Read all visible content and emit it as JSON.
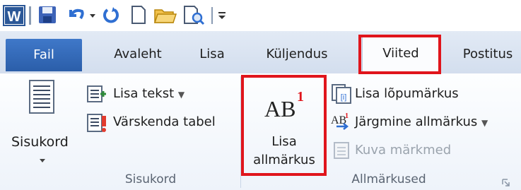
{
  "quick_access": {
    "icons": [
      "word-icon",
      "save-icon",
      "undo-icon",
      "dropdown-arrow-icon",
      "redo-icon",
      "new-document-icon",
      "open-folder-icon",
      "print-preview-icon",
      "customize-qat-icon"
    ]
  },
  "tabs": [
    {
      "label": "Fail"
    },
    {
      "label": "Avaleht"
    },
    {
      "label": "Lisa"
    },
    {
      "label": "Küljendus"
    },
    {
      "label": "Viited"
    },
    {
      "label": "Postitus"
    }
  ],
  "groups": {
    "toc": {
      "label": "Sisukord",
      "big_button": "Sisukord",
      "add_text": "Lisa tekst",
      "update_table": "Värskenda tabel"
    },
    "footnotes": {
      "label": "Allmärkused",
      "insert_footnote_line1": "Lisa",
      "insert_footnote_line2": "allmärkus",
      "ab_icon_text": "AB",
      "ab_superscript": "1",
      "insert_endnote": "Lisa lõpumärkus",
      "next_footnote": "Järgmine allmärkus",
      "show_notes": "Kuva märkmed"
    }
  },
  "colors": {
    "highlight": "#e0151c",
    "file_tab": "#2b5ea9",
    "disabled_text": "#9aa3ad"
  }
}
